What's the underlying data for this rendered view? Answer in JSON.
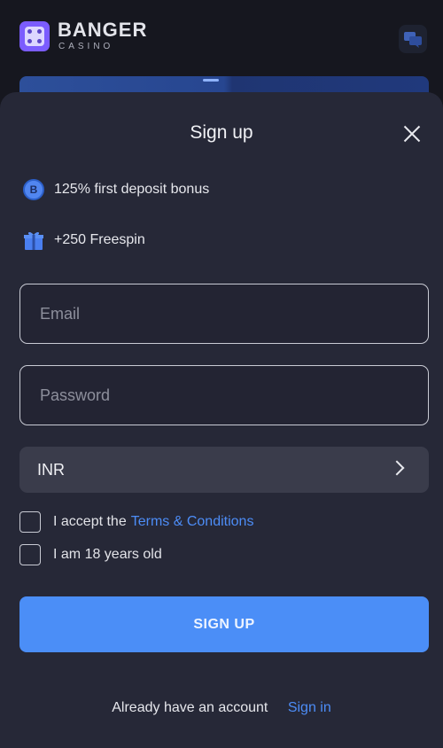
{
  "header": {
    "brand": "BANGER",
    "brand_sub": "CASINO"
  },
  "modal": {
    "title": "Sign up",
    "perks": [
      {
        "icon": "coin-b-icon",
        "text": "125% first deposit bonus"
      },
      {
        "icon": "gift-icon",
        "text": "+250 Freespin"
      }
    ],
    "email_placeholder": "Email",
    "password_placeholder": "Password",
    "currency": "INR",
    "accept_prefix": "I accept the",
    "terms_link": "Terms & Conditions",
    "age_label": "I am 18 years old",
    "submit_label": "SIGN UP",
    "footer_text": "Already have an account",
    "signin_link": "Sign in"
  },
  "colors": {
    "accent": "#4b8ef7",
    "link": "#4d8df7",
    "sheet_bg": "#262837",
    "page_bg": "#16171f"
  }
}
